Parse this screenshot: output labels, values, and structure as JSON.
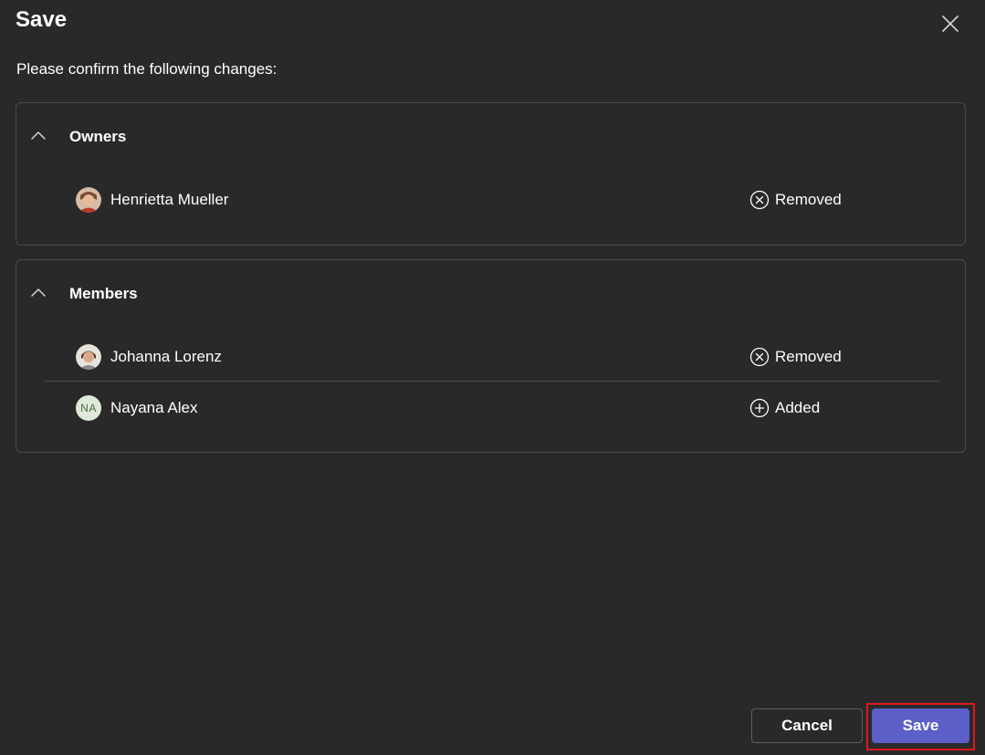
{
  "dialog": {
    "title": "Save",
    "subtitle": "Please confirm the following changes:",
    "close_icon": "close-icon"
  },
  "sections": [
    {
      "title": "Owners",
      "expanded": true,
      "rows": [
        {
          "name": "Henrietta Mueller",
          "avatar": "photo",
          "status": "Removed",
          "status_icon": "circle-x-icon"
        }
      ]
    },
    {
      "title": "Members",
      "expanded": true,
      "rows": [
        {
          "name": "Johanna Lorenz",
          "avatar": "photo",
          "status": "Removed",
          "status_icon": "circle-x-icon"
        },
        {
          "name": "Nayana Alex",
          "avatar": "initials",
          "initials": "NA",
          "status": "Added",
          "status_icon": "circle-plus-icon"
        }
      ]
    }
  ],
  "footer": {
    "cancel_label": "Cancel",
    "save_label": "Save"
  },
  "colors": {
    "background": "#292929",
    "border": "#4a4a4a",
    "primary": "#5b5fc7",
    "highlight": "#e0161e",
    "initials_bg": "#dfe9da"
  }
}
